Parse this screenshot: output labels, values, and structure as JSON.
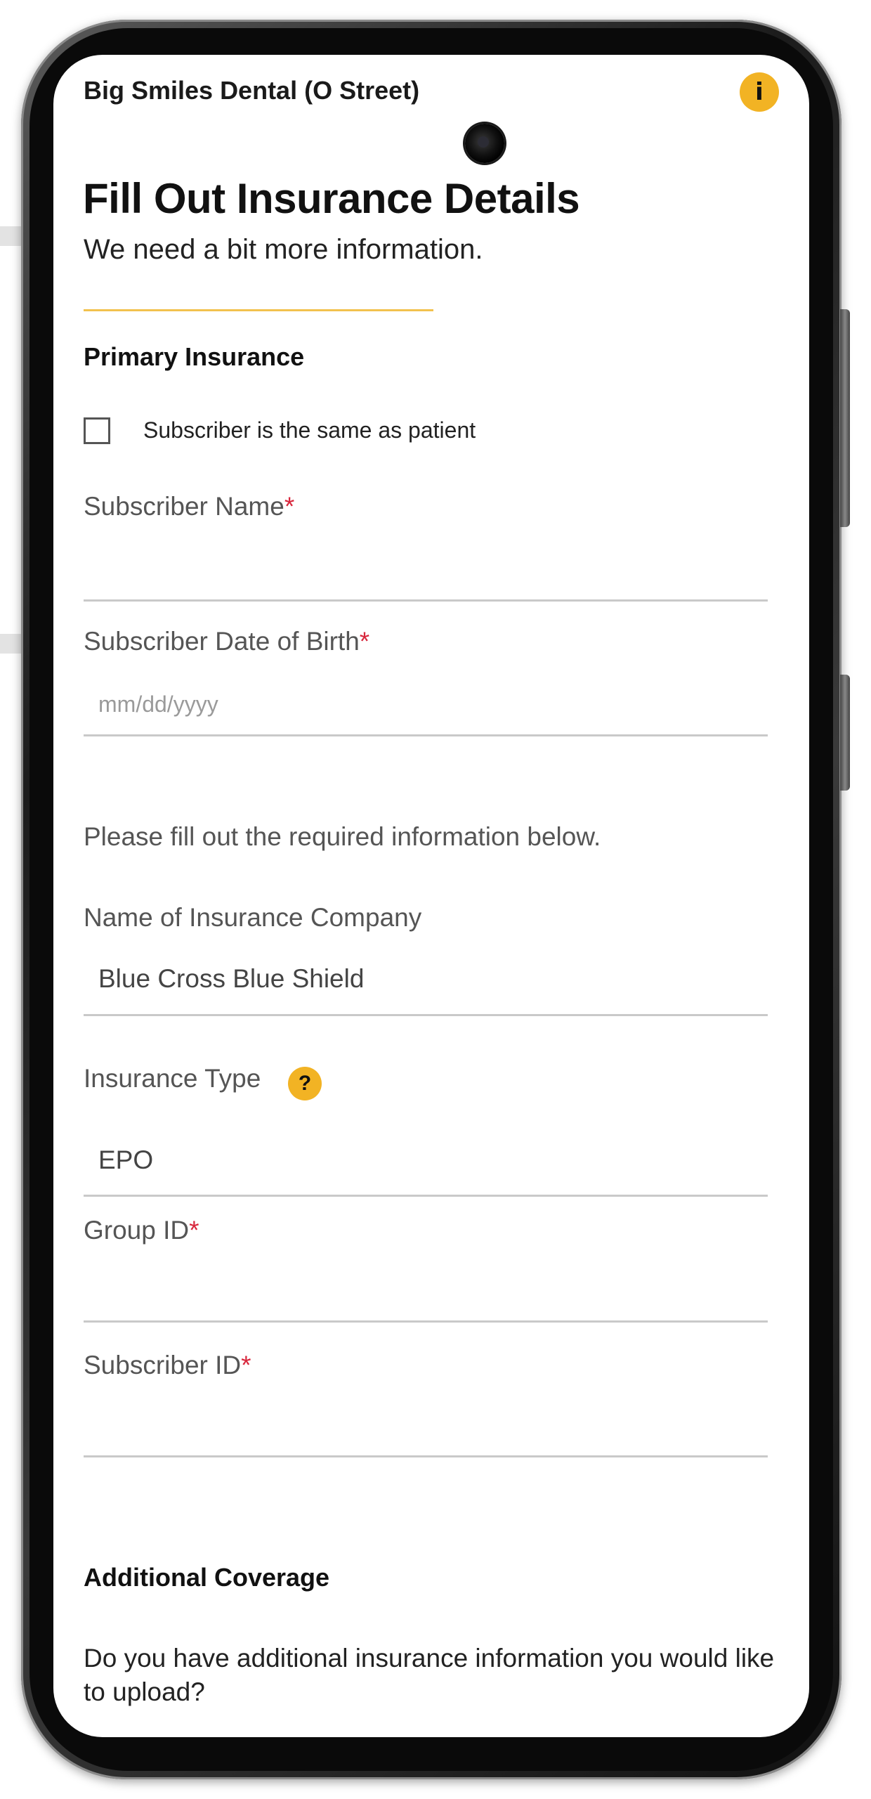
{
  "header": {
    "practice_name": "Big Smiles Dental (O Street)",
    "info_icon_glyph": "i"
  },
  "page": {
    "title": "Fill Out Insurance Details",
    "subtitle": "We need a bit more information."
  },
  "primary_insurance": {
    "heading": "Primary Insurance",
    "same_as_patient_label": "Subscriber is the same as patient",
    "same_as_patient_checked": false,
    "subscriber_name": {
      "label": "Subscriber Name",
      "required_mark": "*",
      "value": ""
    },
    "subscriber_dob": {
      "label": "Subscriber Date of Birth",
      "required_mark": "*",
      "placeholder": "mm/dd/yyyy",
      "value": ""
    },
    "instruction": "Please fill out the required information below.",
    "insurance_company": {
      "label": "Name of Insurance Company",
      "value": "Blue Cross Blue Shield"
    },
    "insurance_type": {
      "label": "Insurance Type",
      "help_glyph": "?",
      "value": "EPO"
    },
    "group_id": {
      "label": "Group ID",
      "required_mark": "*",
      "value": ""
    },
    "subscriber_id": {
      "label": "Subscriber ID",
      "required_mark": "*",
      "value": ""
    }
  },
  "additional_coverage": {
    "heading": "Additional Coverage",
    "question": "Do you have additional insurance information you would like to upload?"
  },
  "colors": {
    "accent": "#f2b324",
    "accent_rule": "#f2c24e",
    "required": "#d8263c",
    "field_line": "#c9c9c9"
  }
}
